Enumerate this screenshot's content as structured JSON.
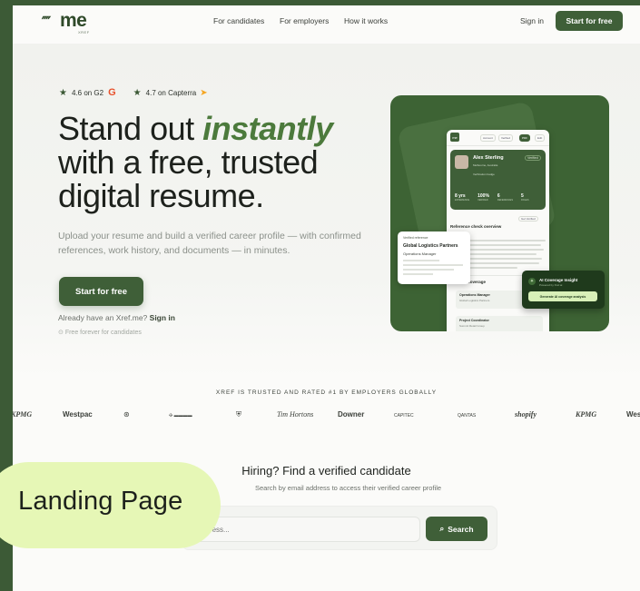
{
  "nav": {
    "logo_text": "me",
    "logo_sub": "XREF",
    "links": [
      "For candidates",
      "For employers",
      "How it works"
    ],
    "sign_in": "Sign in",
    "cta": "Start for free"
  },
  "ratings": {
    "g2": "4.6 on G2",
    "capterra": "4.7 on Capterra"
  },
  "hero": {
    "headline_1": "Stand out ",
    "headline_em": "instantly",
    "headline_2": "with a free, trusted digital resume.",
    "subtext": "Upload your resume and build a verified career profile — with confirmed references, work history, and documents — in minutes.",
    "cta": "Start for free",
    "already": "Already have an Xref.me?",
    "sign_in": "Sign in",
    "free_note": "Free forever for candidates"
  },
  "mock": {
    "pill_1": "Account",
    "pill_2": "Verified",
    "pill_3": "PDF",
    "pill_4": "Edit",
    "name": "Alex Sterling",
    "verified": "Verified",
    "meta_1": "Melbourne, Australia",
    "meta_2": "Verification badge",
    "stats": [
      {
        "value": "8 yrs",
        "label": "EXPERIENCE"
      },
      {
        "value": "100%",
        "label": "VERIFIED"
      },
      {
        "value": "6",
        "label": "REFERENCES"
      },
      {
        "value": "5",
        "label": "ROLES"
      }
    ],
    "ref_title": "Reference check overview",
    "ref_tag": "Get Verified",
    "coverage_title": "Career Coverage",
    "jobs": [
      {
        "title": "Operations Manager",
        "sub": "Global Logistics Partners"
      },
      {
        "title": "Project Coordinator",
        "sub": "Summit Retail Group"
      }
    ],
    "float_left": {
      "tag": "Verified reference",
      "title": "Global Logistics Partners",
      "sub": "Operations Manager"
    },
    "float_right": {
      "title": "AI Coverage Insight",
      "sub": "Powered by Xref.ai",
      "button": "Generate AI coverage analysis"
    }
  },
  "trusted": {
    "heading": "XREF IS TRUSTED AND RATED #1 BY EMPLOYERS GLOBALLY",
    "brands": [
      "KPMG",
      "Westpac",
      "",
      "",
      "",
      "Tim Hortons",
      "Downer",
      "CAPITEC",
      "QANTAS",
      "shopify",
      "KPMG",
      "Wes"
    ]
  },
  "hiring": {
    "title": "Hiring? Find a verified candidate",
    "subtitle": "Search by email address to access their verified career profile",
    "placeholder": "ddress...",
    "button": "Search"
  },
  "badge": {
    "label": "Landing Page"
  },
  "colors": {
    "brand_green": "#3f5f38",
    "accent_lime": "#e6f7b6",
    "frame": "#3c5a36"
  }
}
